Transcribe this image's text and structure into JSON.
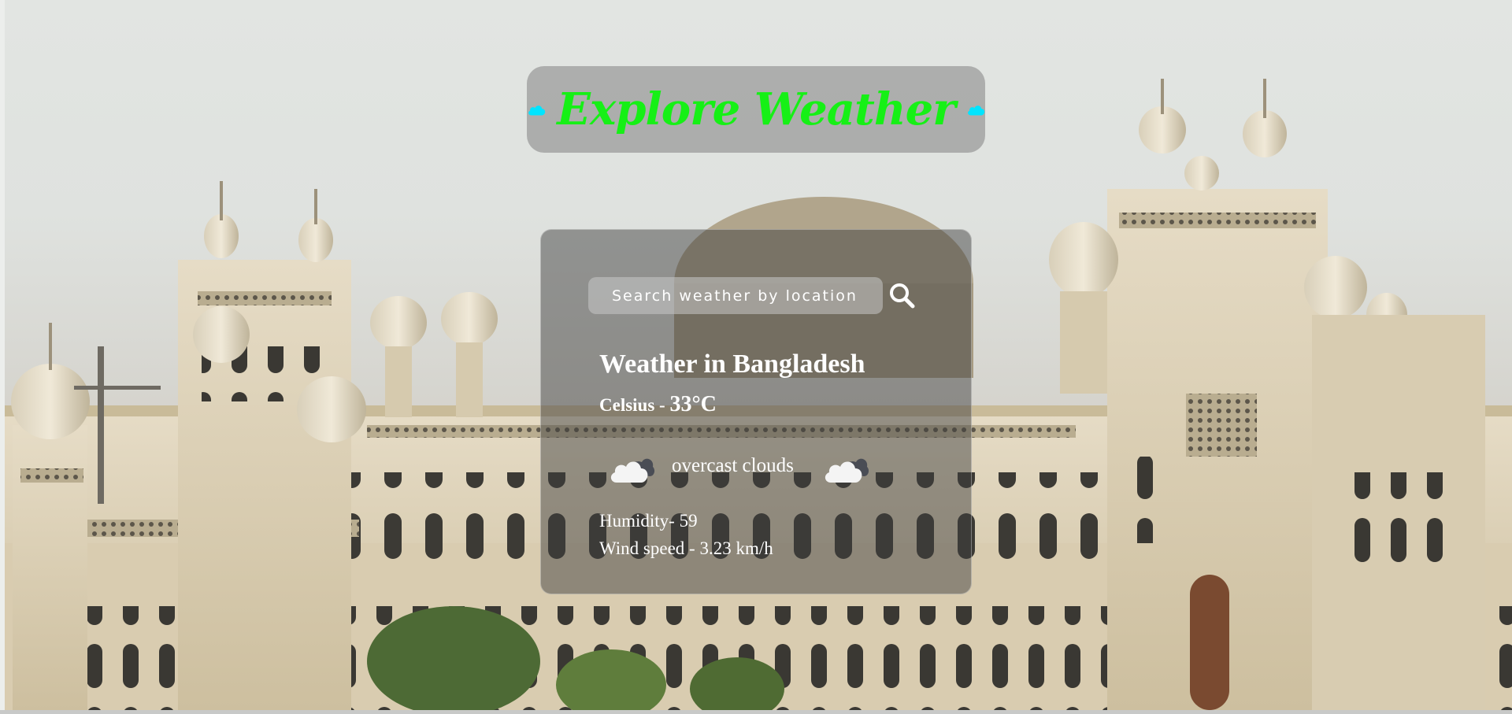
{
  "app": {
    "title": "Explore Weather",
    "title_color": "#16f016",
    "title_icon": "cloud-icon",
    "title_icon_color": "#00e5ff"
  },
  "search": {
    "placeholder": "Search weather by location",
    "value": "",
    "button_icon": "search-icon"
  },
  "weather": {
    "heading": "Weather in Bangladesh",
    "temp_label": "Celsius - ",
    "temp_value": "33°C",
    "description": "overcast clouds",
    "description_icon": "overcast-clouds-icon",
    "humidity": "Humidity- 59",
    "wind": "Wind speed - 3.23 km/h"
  },
  "background": {
    "subject": "palace-building-photo"
  }
}
